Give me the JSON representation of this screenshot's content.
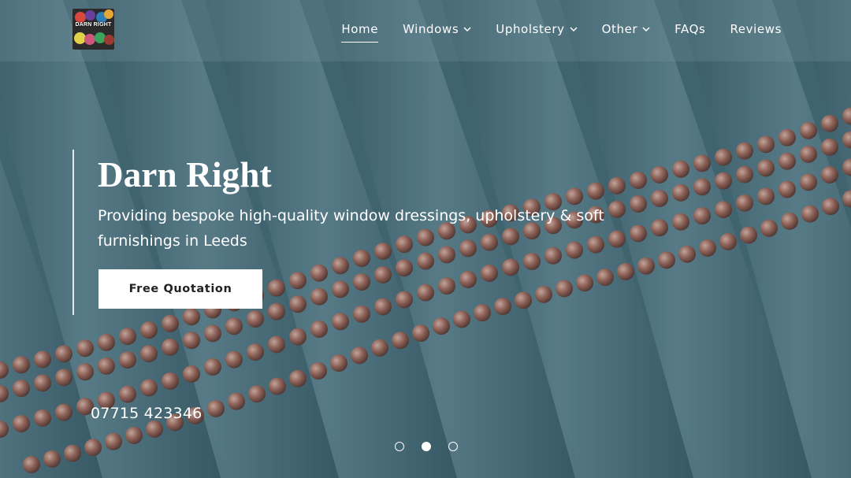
{
  "brand": {
    "logo_text": "DARN RIGHT"
  },
  "nav": {
    "items": [
      {
        "label": "Home",
        "dropdown": false,
        "active": true
      },
      {
        "label": "Windows",
        "dropdown": true,
        "active": false
      },
      {
        "label": "Upholstery",
        "dropdown": true,
        "active": false
      },
      {
        "label": "Other",
        "dropdown": true,
        "active": false
      },
      {
        "label": "FAQs",
        "dropdown": false,
        "active": false
      },
      {
        "label": "Reviews",
        "dropdown": false,
        "active": false
      }
    ]
  },
  "hero": {
    "title": "Darn Right",
    "subtitle": "Providing bespoke high-quality window dressings, upholstery & soft furnishings in Leeds",
    "cta_label": "Free Quotation",
    "phone": "07715 423346"
  },
  "carousel": {
    "slide_count": 3,
    "active_index": 1
  },
  "colors": {
    "fabric": "#4f7784",
    "chain": "#b07a6a",
    "header_overlay": "#7896a0"
  },
  "icons": {
    "chevron": "chevron-down-icon"
  }
}
